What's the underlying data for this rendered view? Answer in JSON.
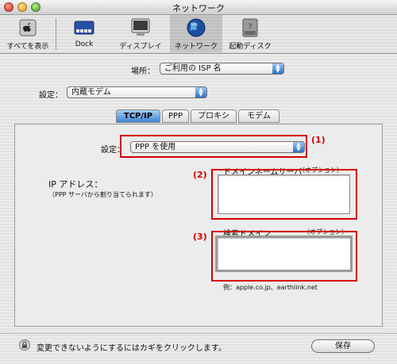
{
  "window": {
    "title": "ネットワーク"
  },
  "toolbar": {
    "items": [
      {
        "label": "すべてを表示",
        "icon": "apple-grid-icon"
      },
      {
        "label": "Dock",
        "icon": "dock-icon"
      },
      {
        "label": "ディスプレイ",
        "icon": "display-icon"
      },
      {
        "label": "ネットワーク",
        "icon": "globe-icon",
        "selected": true
      },
      {
        "label": "起動ディスク",
        "icon": "disk-icon"
      }
    ]
  },
  "location": {
    "label": "場所：",
    "value": "ご利用の ISP 名"
  },
  "settings": {
    "label": "設定：",
    "value": "内蔵モデム"
  },
  "tabs": [
    {
      "label": "TCP/IP",
      "active": true
    },
    {
      "label": "PPP"
    },
    {
      "label": "プロキシ"
    },
    {
      "label": "モデム"
    }
  ],
  "panel": {
    "config_label": "設定：",
    "config_value": "PPP を使用",
    "ip_label": "IP アドレス：",
    "ip_note": "（PPP サーバから割り当てられます）",
    "dns_label": "ドメインネームサーバ",
    "dns_optional": "（オプション）",
    "search_label": "検索ドメイン",
    "search_optional": "（オプション）",
    "example": "例：apple.co.jp、earthlink.net",
    "dns_value": "",
    "search_value": ""
  },
  "annotations": [
    "(1)",
    "(2)",
    "(3)"
  ],
  "footer": {
    "lock_text": "変更できないようにするにはカギをクリックします。",
    "save_label": "保存"
  },
  "colors": {
    "annotation_red": "#d40000",
    "active_tab_blue": "#3f86d6",
    "popup_arrow_blue": "#2c6fc4"
  }
}
